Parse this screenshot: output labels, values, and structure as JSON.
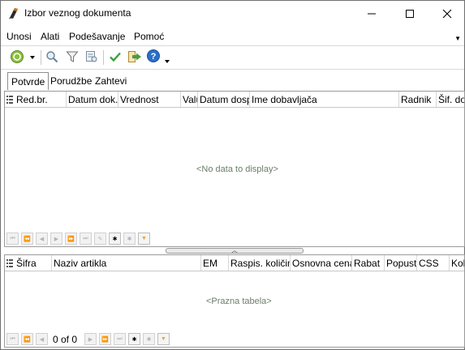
{
  "window": {
    "title": "Izbor veznog dokumenta",
    "minimize_glyph": "—",
    "maximize_glyph": "☐",
    "close_glyph": "✕"
  },
  "menu": {
    "items": [
      "Unosi",
      "Alati",
      "Podešavanje",
      "Pomoć"
    ],
    "overflow_glyph": "▼"
  },
  "toolbar": {
    "icons": [
      "refresh-dropdown-icon",
      "search-icon",
      "filter-icon",
      "filter-settings-icon",
      "check-icon",
      "exit-icon",
      "help-icon"
    ]
  },
  "tabs": [
    "Potvrde",
    "Porudžbe",
    "Zahtevi"
  ],
  "top_grid": {
    "columns": [
      "Red.br.",
      "Datum dok.",
      "Vrednost",
      "Valu",
      "Datum dosp",
      "Ime dobavljača",
      "Radnik",
      "Šif. do"
    ],
    "empty_text": "<No data to display>",
    "nav_glyphs": [
      "⏮",
      "⏪",
      "◀",
      "▶",
      "⏩",
      "⏭",
      "✎",
      "✱",
      "✱",
      "▼"
    ]
  },
  "splitter_glyph": "︿",
  "bottom_grid": {
    "columns": [
      "Šifra",
      "Naziv artikla",
      "EM",
      "Raspis. količina",
      "Osnovna cena",
      "Rabat",
      "Popust",
      "CSS",
      "Kol"
    ],
    "empty_text": "<Prazna tabela>",
    "pager_text": "0 of 0",
    "nav_glyphs": [
      "⏮",
      "⏪",
      "◀",
      "▶",
      "⏩",
      "⏭",
      "✱",
      "✱",
      "▼"
    ]
  },
  "colors": {
    "border": "#9a9a9a",
    "empty_text": "#6b7d6b",
    "check_green": "#3aa23a",
    "help_blue": "#2a6fc9",
    "filter_orange": "#f0a020"
  }
}
